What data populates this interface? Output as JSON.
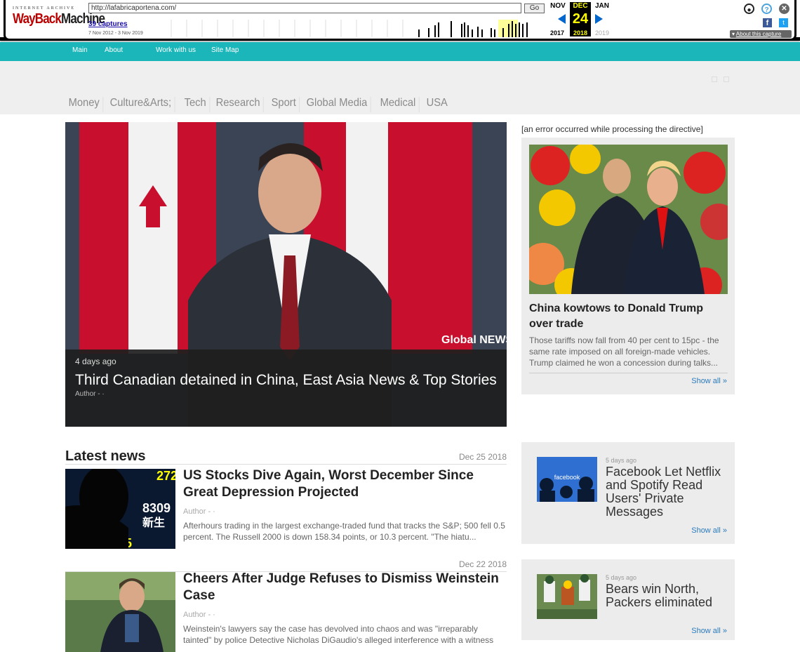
{
  "wayback": {
    "logo_top": "INTERNET ARCHIVE",
    "logo_main_1": "WayBack",
    "logo_main_2": "Machine",
    "url": "http://lafabricaportena.com/",
    "go_label": "Go",
    "captures": "39 captures",
    "range": "7 Nov 2012 - 3 Nov 2019",
    "month_prev": "NOV",
    "month_cur": "DEC",
    "month_next": "JAN",
    "day": "24",
    "year_prev": "2017",
    "year_cur": "2018",
    "year_next": "2019",
    "about_label": "About this capture",
    "fb_label": "f",
    "tw_label": "t"
  },
  "topnav": {
    "main": "Main",
    "about": "About",
    "work": "Work with us",
    "sitemap": "Site Map"
  },
  "categories": [
    "Money",
    "Culture&Arts;",
    "Tech",
    "Research",
    "Sport",
    "Global Media",
    "Medical",
    "USA"
  ],
  "hero": {
    "time": "4 days ago",
    "title": "Third Canadian detained in China, East Asia News & Top Stories",
    "author": "Author - ·",
    "logo": "Global NEWS"
  },
  "sidebar": {
    "error": "[an error occurred while processing the directive]",
    "card1": {
      "title": "China kowtows to Donald Trump over trade",
      "text": "Those tariffs now fall from 40 per cent to 15pc - the same rate imposed on all foreign-made vehicles. Trump claimed he won a concession during talks...",
      "show_all": "Show all »"
    },
    "card2": {
      "time": "5 days ago",
      "title": "Facebook Let Netflix and Spotify Read Users' Private Messages",
      "show_all": "Show all »",
      "img_label": "facebook"
    },
    "card3": {
      "time": "5 days ago",
      "title": "Bears win North, Packers eliminated",
      "show_all": "Show all »"
    }
  },
  "latest": {
    "heading": "Latest news",
    "items": [
      {
        "date": "Dec 25 2018",
        "title": "US Stocks Dive Again, Worst December Since Great Depression Projected",
        "author": "Author - ·",
        "text": "Afterhours trading in the largest exchange-traded fund that tracks the S&P; 500 fell 0.5 percent. The Russell 2000 is down 158.34 points, or 10.3 percent. \"The hiatu..."
      },
      {
        "date": "Dec 22 2018",
        "title": "Cheers After Judge Refuses to Dismiss Weinstein Case",
        "author": "Author - ·",
        "text": "Weinstein's lawyers say the case has devolved into chaos and was \"irreparably tainted\" by police Detective Nicholas DiGaudio's alleged interference with a witness"
      }
    ]
  }
}
